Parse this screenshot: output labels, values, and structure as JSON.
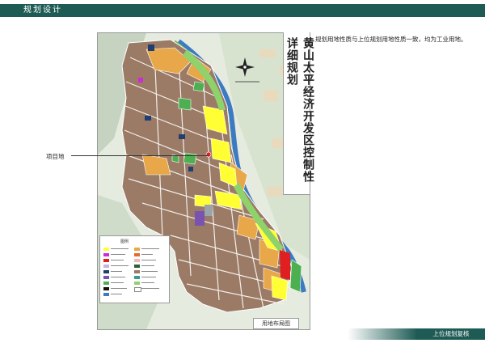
{
  "header": {
    "title": "规划设计"
  },
  "map": {
    "vertical_title": "黄山太平经济开发区控制性详细规划",
    "caption": "用地布局图",
    "legend_title": "图例",
    "legend_rows": 13
  },
  "annotation": {
    "project_site": "项目地"
  },
  "description": "规划用地性质与上位规划用地性质一致，均为工业用地。",
  "footer": {
    "label": "上位规划复核"
  },
  "colors": {
    "header_band": "#1e5b55",
    "industrial": "#9b7a66",
    "residential": "#e8a84a",
    "commercial": "#ffff33",
    "green": "#4caf50",
    "water": "#3c7ac1",
    "red_zone": "#e02020",
    "magenta": "#cc2cd1",
    "purple": "#7a52b0",
    "navy": "#1f3f70"
  }
}
